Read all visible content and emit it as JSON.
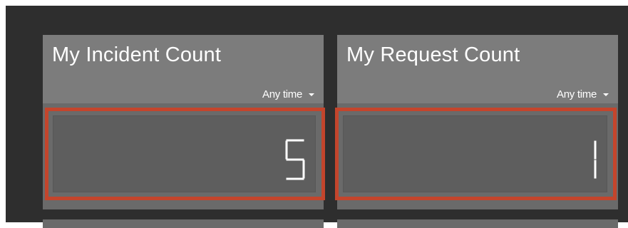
{
  "tiles": [
    {
      "title": "My Incident Count",
      "filter": "Any time",
      "count": "5"
    },
    {
      "title": "My Request Count",
      "filter": "Any time",
      "count": "1"
    }
  ],
  "colors": {
    "background": "#2e2e2e",
    "tile": "#6a6a6a",
    "tile_header": "#7c7c7c",
    "highlight": "#c4452c",
    "text": "#ffffff"
  },
  "icons": {
    "filter_dropdown": "caret-down-icon"
  }
}
